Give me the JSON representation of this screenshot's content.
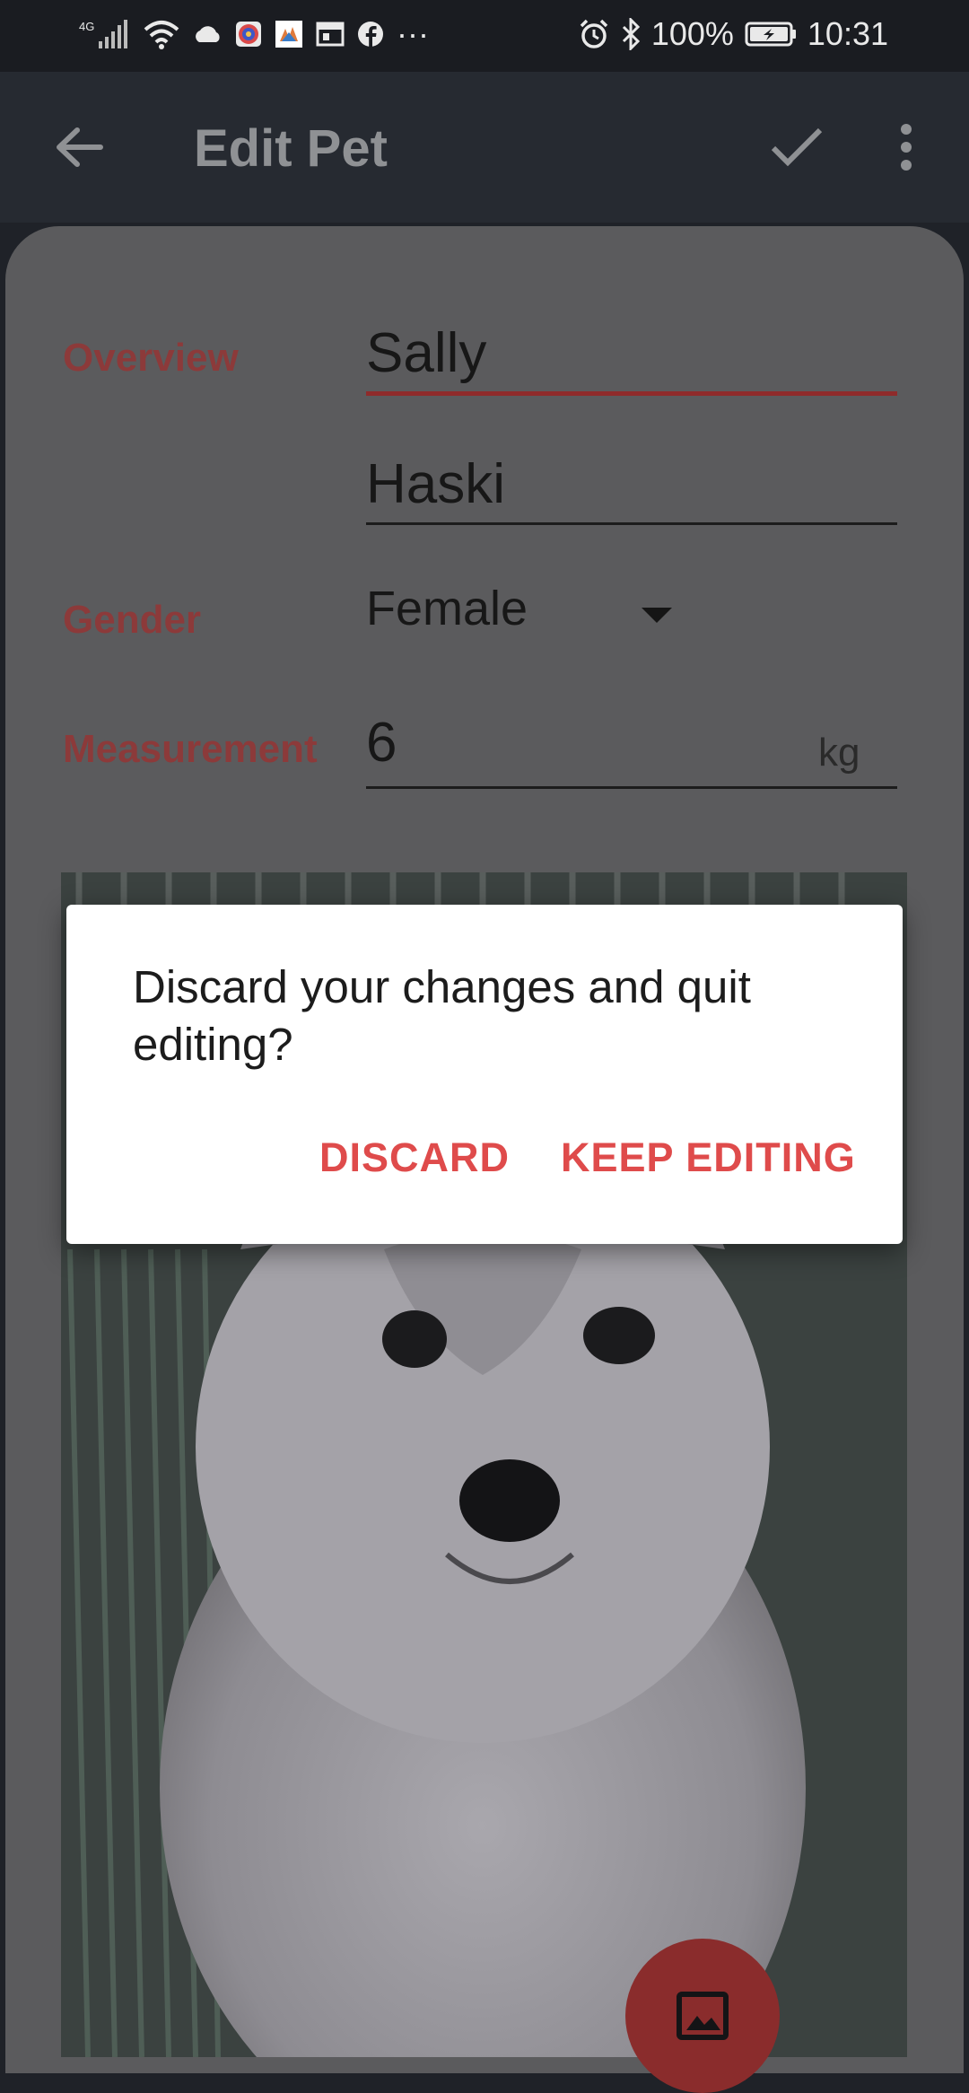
{
  "status_bar": {
    "network": "4G",
    "battery": "100%",
    "time": "10:31",
    "more": "···",
    "left_icons": [
      "signal-icon",
      "wifi-icon",
      "cloud-icon",
      "target-app-icon",
      "photos-app-icon",
      "calendar-app-icon",
      "facebook-icon"
    ],
    "right_icons": [
      "alarm-icon",
      "bluetooth-icon",
      "battery-charging-icon"
    ]
  },
  "app_bar": {
    "title": "Edit Pet",
    "back_icon": "arrow-back-icon",
    "save_icon": "check-icon",
    "menu_icon": "more-vert-icon"
  },
  "form": {
    "overview_label": "Overview",
    "name_value": "Sally",
    "breed_value": "Haski",
    "gender_label": "Gender",
    "gender_value": "Female",
    "measurement_label": "Measurement",
    "weight_value": "6",
    "weight_unit": "kg"
  },
  "image": {
    "subject": "husky puppy photo",
    "fab_icon": "image-icon"
  },
  "dialog": {
    "message": "Discard your changes and quit editing?",
    "discard_label": "DISCARD",
    "keep_label": "KEEP EDITING"
  },
  "colors": {
    "accent": "#df4b4b",
    "appbar_bg": "#262a31",
    "scrim_card": "#5b5b5d"
  }
}
